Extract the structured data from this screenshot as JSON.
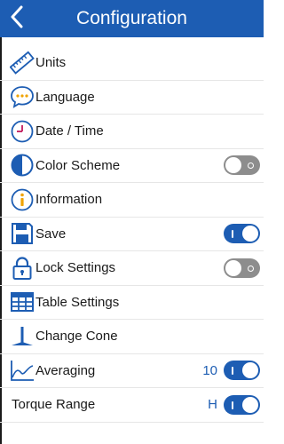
{
  "header": {
    "title": "Configuration",
    "back_icon": "chevron-left-icon"
  },
  "colors": {
    "accent": "#1d5db3",
    "toggle_off": "#8d8d8d"
  },
  "items": [
    {
      "label": "Units",
      "icon": "ruler-icon"
    },
    {
      "label": "Language",
      "icon": "chat-bubble-icon"
    },
    {
      "label": "Date / Time",
      "icon": "clock-icon"
    },
    {
      "label": "Color Scheme",
      "icon": "contrast-icon",
      "toggle": "off"
    },
    {
      "label": "Information",
      "icon": "info-icon"
    },
    {
      "label": "Save",
      "icon": "floppy-disk-icon",
      "toggle": "on"
    },
    {
      "label": "Lock Settings",
      "icon": "lock-icon",
      "toggle": "off"
    },
    {
      "label": "Table Settings",
      "icon": "table-grid-icon"
    },
    {
      "label": "Change Cone",
      "icon": "cone-icon"
    },
    {
      "label": "Averaging",
      "icon": "line-graph-icon",
      "value": "10",
      "toggle": "on"
    },
    {
      "label": "Torque Range",
      "value": "H",
      "toggle": "on"
    }
  ]
}
